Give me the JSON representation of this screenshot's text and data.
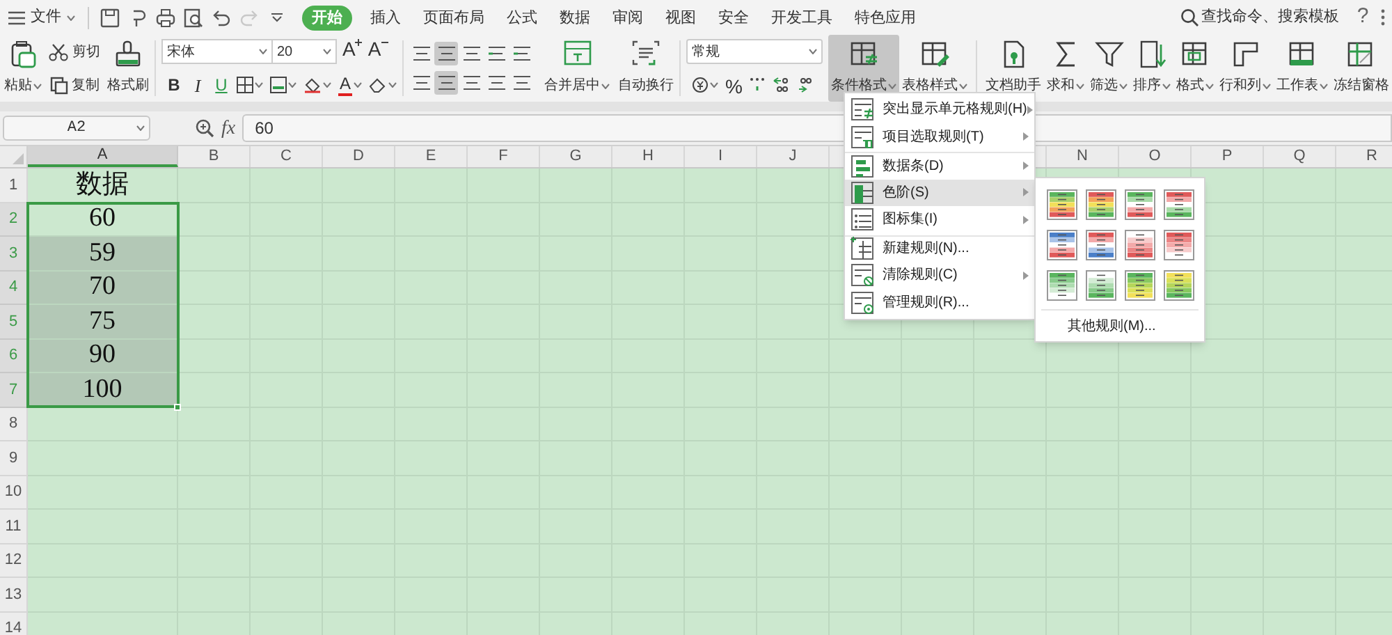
{
  "top_bar": {
    "file": "文件",
    "redo": {
      "disabled": true
    },
    "tabs": [
      {
        "label": "开始",
        "selected": true
      },
      {
        "label": "插入",
        "selected": false
      },
      {
        "label": "页面布局",
        "selected": false
      },
      {
        "label": "公式",
        "selected": false
      },
      {
        "label": "数据",
        "selected": false
      },
      {
        "label": "审阅",
        "selected": false
      },
      {
        "label": "视图",
        "selected": false
      },
      {
        "label": "安全",
        "selected": false
      },
      {
        "label": "开发工具",
        "selected": false
      },
      {
        "label": "特色应用",
        "selected": false
      }
    ],
    "search": "查找命令、搜索模板",
    "help": "?"
  },
  "ribbon": {
    "paste": "粘贴",
    "cut": "剪切",
    "copy": "复制",
    "format_painter": "格式刷",
    "font_name": "宋体",
    "font_size": "20",
    "grow_font": "A",
    "shrink_font": "A",
    "style_buttons": [
      "B",
      "I",
      "U"
    ],
    "font_color": "A",
    "merge": "合并居中",
    "wrap": "自动换行",
    "number_format": "常规",
    "percent": "%",
    "big_buttons": [
      {
        "label": "条件格式",
        "dropdown": true,
        "pressed": true
      },
      {
        "label": "表格样式",
        "dropdown": true,
        "pressed": false
      },
      {
        "label": "文档助手",
        "dropdown": false,
        "pressed": false
      },
      {
        "label": "求和",
        "dropdown": true,
        "pressed": false
      },
      {
        "label": "筛选",
        "dropdown": true,
        "pressed": false
      },
      {
        "label": "排序",
        "dropdown": true,
        "pressed": false
      },
      {
        "label": "格式",
        "dropdown": true,
        "pressed": false
      },
      {
        "label": "行和列",
        "dropdown": true,
        "pressed": false
      },
      {
        "label": "工作表",
        "dropdown": true,
        "pressed": false
      },
      {
        "label": "冻结窗格",
        "dropdown": false,
        "pressed": false
      }
    ]
  },
  "formula_bar": {
    "name_box": "A2",
    "fx": "fx",
    "value": "60"
  },
  "columns": [
    {
      "label": "A",
      "selected": true
    },
    {
      "label": "B",
      "selected": false
    },
    {
      "label": "C",
      "selected": false
    },
    {
      "label": "D",
      "selected": false
    },
    {
      "label": "E",
      "selected": false
    },
    {
      "label": "F",
      "selected": false
    },
    {
      "label": "G",
      "selected": false
    },
    {
      "label": "H",
      "selected": false
    },
    {
      "label": "I",
      "selected": false
    },
    {
      "label": "J",
      "selected": false
    },
    {
      "label": "N",
      "selected": false
    },
    {
      "label": "O",
      "selected": false
    },
    {
      "label": "P",
      "selected": false
    },
    {
      "label": "Q",
      "selected": false
    },
    {
      "label": "R",
      "selected": false
    }
  ],
  "rows": [
    {
      "label": "1",
      "selected": false,
      "cell": "数据"
    },
    {
      "label": "2",
      "selected": true,
      "cell": "60"
    },
    {
      "label": "3",
      "selected": true,
      "cell": "59"
    },
    {
      "label": "4",
      "selected": true,
      "cell": "70"
    },
    {
      "label": "5",
      "selected": true,
      "cell": "75"
    },
    {
      "label": "6",
      "selected": true,
      "cell": "90"
    },
    {
      "label": "7",
      "selected": true,
      "cell": "100"
    },
    {
      "label": "8",
      "selected": false
    },
    {
      "label": "9",
      "selected": false
    },
    {
      "label": "10",
      "selected": false
    },
    {
      "label": "11",
      "selected": false
    },
    {
      "label": "12",
      "selected": false
    },
    {
      "label": "13",
      "selected": false
    },
    {
      "label": "14",
      "selected": false
    }
  ],
  "context_menu": {
    "items": [
      {
        "label": "突出显示单元格规则(H)",
        "has_submenu": true,
        "selected": false,
        "separator_before": false
      },
      {
        "label": "项目选取规则(T)",
        "has_submenu": true,
        "selected": false,
        "separator_before": false
      },
      {
        "label": "数据条(D)",
        "has_submenu": true,
        "selected": false,
        "separator_before": true
      },
      {
        "label": "色阶(S)",
        "has_submenu": true,
        "selected": true,
        "separator_before": false
      },
      {
        "label": "图标集(I)",
        "has_submenu": true,
        "selected": false,
        "separator_before": false
      },
      {
        "label": "新建规则(N)...",
        "has_submenu": false,
        "selected": false,
        "separator_before": true
      },
      {
        "label": "清除规则(C)",
        "has_submenu": true,
        "selected": false,
        "separator_before": false
      },
      {
        "label": "管理规则(R)...",
        "has_submenu": false,
        "selected": false,
        "separator_before": false
      }
    ],
    "submenu": {
      "more": "其他规则(M)..."
    }
  }
}
